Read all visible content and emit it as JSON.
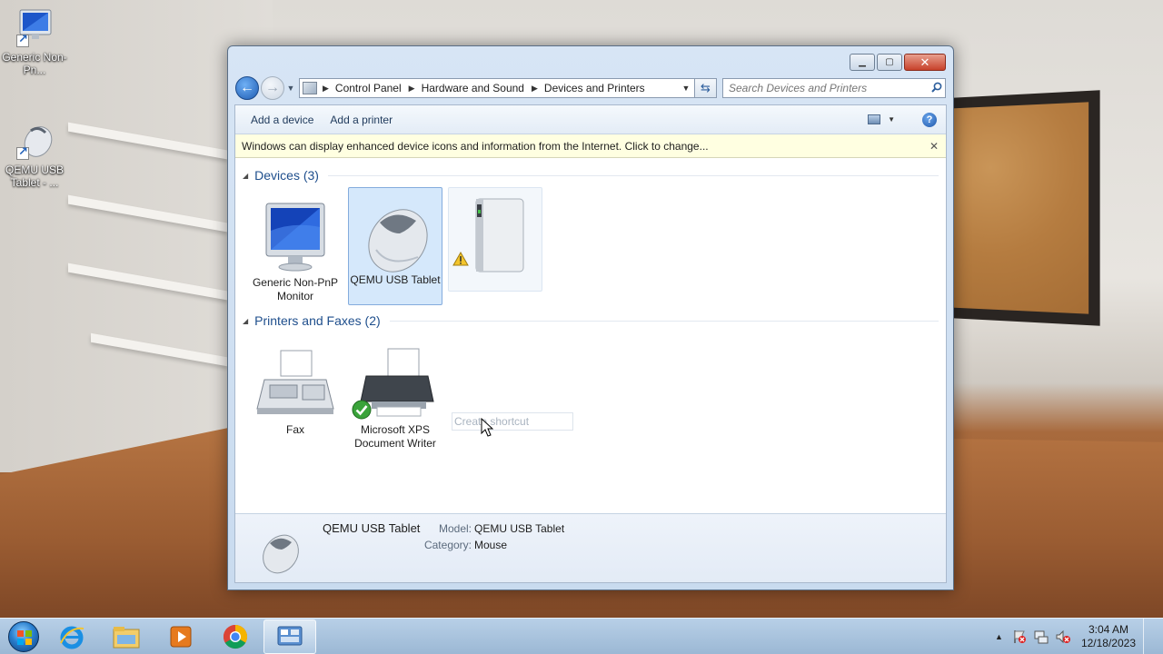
{
  "desktop": {
    "icons": [
      {
        "label": "Generic Non-Pn...",
        "icon": "monitor-icon"
      },
      {
        "label": "QEMU USB Tablet - ...",
        "icon": "mouse-icon"
      }
    ]
  },
  "window": {
    "breadcrumb": [
      "Control Panel",
      "Hardware and Sound",
      "Devices and Printers"
    ],
    "search_placeholder": "Search Devices and Printers",
    "commands": {
      "add_device": "Add a device",
      "add_printer": "Add a printer"
    },
    "infobar": "Windows can display enhanced device icons and information from the Internet. Click to change...",
    "groups": {
      "devices": {
        "title": "Devices (3)",
        "items": [
          {
            "label": "Generic Non-PnP Monitor",
            "icon": "monitor-icon"
          },
          {
            "label": "QEMU USB Tablet",
            "icon": "mouse-icon",
            "selected": true
          },
          {
            "label": "",
            "icon": "external-drive-icon",
            "warning": true
          }
        ]
      },
      "printers": {
        "title": "Printers and Faxes (2)",
        "items": [
          {
            "label": "Fax",
            "icon": "fax-icon"
          },
          {
            "label": "Microsoft XPS Document Writer",
            "icon": "printer-icon",
            "default": true
          }
        ]
      }
    },
    "drag_tooltip": "Create shortcut",
    "details": {
      "name": "QEMU USB Tablet",
      "model_label": "Model:",
      "model_value": "QEMU USB Tablet",
      "category_label": "Category:",
      "category_value": "Mouse"
    }
  },
  "taskbar": {
    "pinned": [
      "internet-explorer-icon",
      "windows-explorer-icon",
      "media-player-icon",
      "chrome-icon",
      "devices-and-printers-icon"
    ],
    "clock": {
      "time": "3:04 AM",
      "date": "12/18/2023"
    }
  },
  "colors": {
    "accent": "#1e4e8c",
    "selection": "#d5e8fb",
    "infobar": "#ffffe1"
  }
}
